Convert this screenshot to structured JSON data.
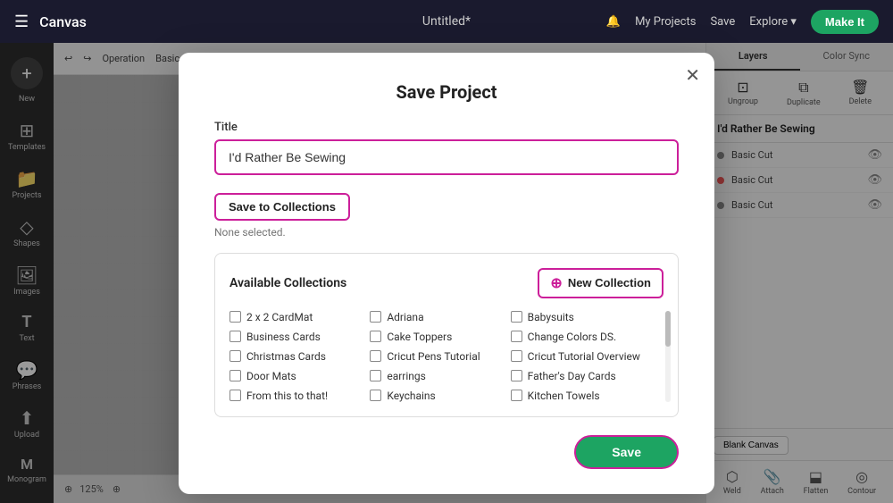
{
  "app": {
    "name": "Canvas",
    "document_title": "Untitled*"
  },
  "topbar": {
    "title": "Canvas",
    "document": "Untitled*",
    "my_projects": "My Projects",
    "save": "Save",
    "explore": "Explore",
    "make_it": "Make It"
  },
  "sidebar": {
    "items": [
      {
        "label": "New",
        "icon": "+"
      },
      {
        "label": "Templates",
        "icon": "⊞"
      },
      {
        "label": "Projects",
        "icon": "📁"
      },
      {
        "label": "Shapes",
        "icon": "◇"
      },
      {
        "label": "Images",
        "icon": "🖼"
      },
      {
        "label": "Text",
        "icon": "T"
      },
      {
        "label": "Phrases",
        "icon": "💬"
      },
      {
        "label": "Upload",
        "icon": "⬆"
      },
      {
        "label": "Monogram",
        "icon": "M"
      }
    ]
  },
  "canvas": {
    "toolbar": {
      "operation": "Operation",
      "basic_cut": "Basic Cut"
    },
    "zoom": "125%",
    "footer_blank": "Blank Canvas"
  },
  "right_panel": {
    "tabs": [
      "Layers",
      "Color Sync"
    ],
    "actions": [
      "Ungroup",
      "Duplicate",
      "Delete"
    ],
    "layer_title": "I'd Rather Be Sewing",
    "layers": [
      {
        "name": "Basic Cut",
        "dot_color": "default"
      },
      {
        "name": "Basic Cut",
        "dot_color": "red"
      },
      {
        "name": "Basic Cut",
        "dot_color": "default"
      }
    ],
    "bottom_actions": [
      "Weld",
      "Attach",
      "Flatten",
      "Contour"
    ]
  },
  "modal": {
    "title": "Save Project",
    "title_label": "Title",
    "title_value": "I'd Rather Be Sewing",
    "save_to_collections_label": "Save to Collections",
    "none_selected": "None selected.",
    "available_collections": "Available Collections",
    "new_collection_label": "New Collection",
    "collections": [
      {
        "col": 1,
        "items": [
          "2 x 2 CardMat",
          "Business Cards",
          "Christmas Cards",
          "Door Mats",
          "From this to that!"
        ]
      },
      {
        "col": 2,
        "items": [
          "Adriana",
          "Cake Toppers",
          "Cricut Pens Tutorial",
          "earrings",
          "Keychains"
        ]
      },
      {
        "col": 3,
        "items": [
          "Babysuits",
          "Change Colors DS.",
          "Cricut Tutorial Overview",
          "Father's Day Cards",
          "Kitchen Towels"
        ]
      }
    ],
    "save_label": "Save"
  }
}
